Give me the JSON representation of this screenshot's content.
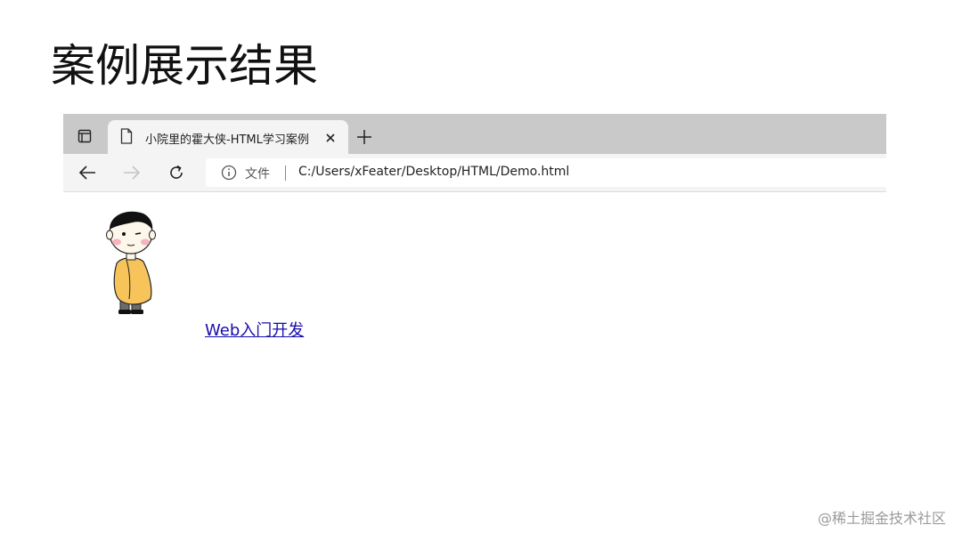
{
  "slide": {
    "title": "案例展示结果"
  },
  "browser": {
    "tab": {
      "title": "小院里的霍大侠-HTML学习案例",
      "close_label": "×",
      "icon": "document-icon"
    },
    "new_tab_label": "+",
    "toolbar": {
      "back_icon": "arrow-left-icon",
      "forward_icon": "arrow-right-icon",
      "refresh_icon": "refresh-icon"
    },
    "address": {
      "scheme_label": "文件",
      "url": "C:/Users/xFeater/Desktop/HTML/Demo.html",
      "info_icon": "info-icon"
    },
    "page": {
      "link_text": "Web入门开发",
      "image_icon": "cartoon-boy-icon"
    }
  },
  "watermark": "@稀土掘金技术社区",
  "colors": {
    "tabstrip": "#c9c9c9",
    "toolbar": "#f4f4f4",
    "link": "#1a0dab",
    "robe": "#f6c45a"
  }
}
